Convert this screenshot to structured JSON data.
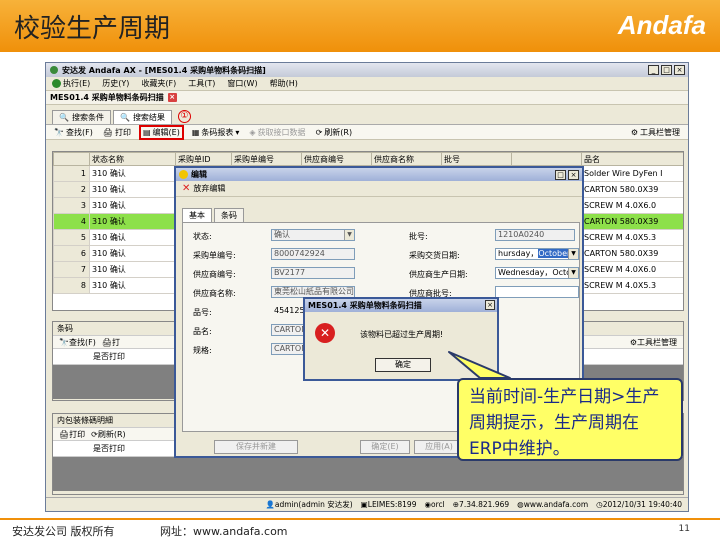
{
  "slide": {
    "title": "校验生产周期",
    "logo": "Andafa",
    "footer_left": "安达发公司 版权所有",
    "footer_web": "网址：www.andafa.com",
    "page_number": "11"
  },
  "app": {
    "title": "安达发 Andafa AX - [MES01.4 采购单物料条码扫描]",
    "menu": [
      {
        "label": "执行(E)",
        "icon": "run-icon"
      },
      {
        "label": "历史(Y)"
      },
      {
        "label": "收藏夹(F)"
      },
      {
        "label": "工具(T)"
      },
      {
        "label": "窗口(W)"
      },
      {
        "label": "帮助(H)"
      }
    ],
    "doc_tab": "MES01.4 采购单物料条码扫描",
    "sub_tabs": [
      "搜索条件",
      "搜索结果"
    ],
    "marker": "①",
    "toolbar": {
      "find": "查找(F)",
      "print": "打印",
      "edit": "编辑(E)",
      "barcode_report": "条码报表",
      "get_interface": "获取接口数据",
      "refresh": "刷新(R)",
      "tool_manager": "工具栏管理"
    },
    "grid": {
      "columns": [
        "",
        "状态名称",
        "采购单ID",
        "采购单编号",
        "供应商编号",
        "供应商名称",
        "批号",
        "",
        "品名"
      ],
      "rows": [
        {
          "num": "1",
          "status": "310 确认",
          "name": "Solder Wire DyFen I"
        },
        {
          "num": "2",
          "status": "310 确认",
          "name": "CARTON 580.0X39"
        },
        {
          "num": "3",
          "status": "310 确认",
          "name": "SCREW M 4.0X6.0"
        },
        {
          "num": "4",
          "status": "310 确认",
          "name": "CARTON 580.0X39"
        },
        {
          "num": "5",
          "status": "310 确认",
          "name": "SCREW M 4.0X5.3"
        },
        {
          "num": "6",
          "status": "310 确认",
          "name": "CARTON 580.0X39"
        },
        {
          "num": "7",
          "status": "310 确认",
          "name": "SCREW M 4.0X6.0"
        },
        {
          "num": "8",
          "status": "310 确认",
          "name": "SCREW M 4.0X5.3"
        }
      ]
    },
    "lower_panel": {
      "tab": "条码",
      "find": "查找(F)",
      "print": "打",
      "tool_manager": "工具栏管理",
      "column": "是否打印"
    },
    "lower_panel2": {
      "tab": "内包装條碼明細",
      "print": "打印",
      "refresh": "刷新(R)",
      "column": "是否打印"
    },
    "status": {
      "user": "admin(admin 安达发)",
      "server": "LEIMES:8199",
      "db": "orcl",
      "ip": "7.34.821.969",
      "web": "www.andafa.com",
      "datetime": "2012/10/31 19:40:40"
    }
  },
  "dialog": {
    "title": "编辑",
    "action": "放弃编辑",
    "tabs": [
      "基本",
      "条码"
    ],
    "fields": {
      "status_label": "状态:",
      "status_value": "确认",
      "po_no_label": "采购单编号:",
      "po_no_value": "8000742924",
      "vendor_no_label": "供应商编号:",
      "vendor_no_value": "BV2177",
      "vendor_name_label": "供应商名称:",
      "vendor_name_value": "東莞松山紙品有限公司",
      "item_no_label": "品号:",
      "item_no_value": "454125",
      "item_name_label": "品名:",
      "item_name_value": "CARTON",
      "spec_label": "规格:",
      "spec_value": "CARTON",
      "lot_label": "批号:",
      "lot_value": "1210A0240",
      "delivery_label": "采购交货日期:",
      "delivery_value_a": "hursday，",
      "delivery_value_b": "October",
      "mfg_date_label": "供应商生产日期:",
      "mfg_date_value": "Wednesday，Octobe",
      "vendor_lot_label": "供应商批号:"
    },
    "buttons": {
      "save_new": "保存并新建",
      "confirm": "确定(E)",
      "apply": "应用(A)"
    }
  },
  "msgbox": {
    "title": "MES01.4 采购单物料条码扫描",
    "message": "该物料已超过生产周期!",
    "ok": "确定"
  },
  "callout": {
    "text": "当前时间-生产日期>生产周期提示，生产周期在ERP中维护。"
  }
}
